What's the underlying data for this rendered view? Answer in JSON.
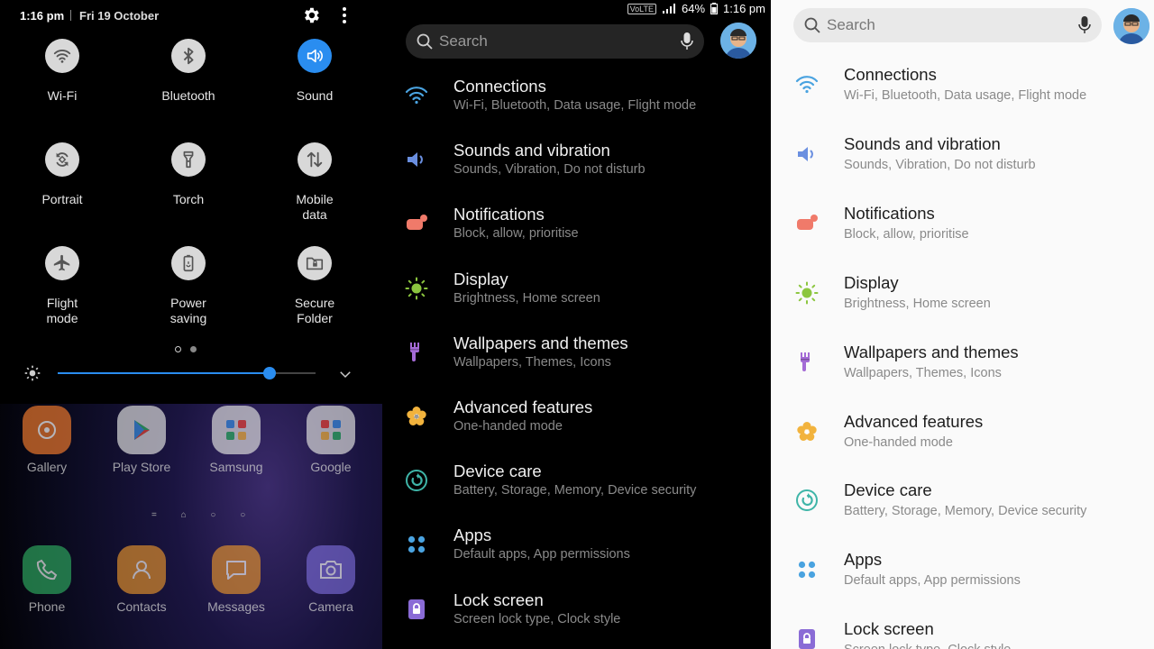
{
  "quick_panel": {
    "time": "1:16 pm",
    "date": "Fri 19 October",
    "tiles": [
      {
        "label": "Wi-Fi",
        "icon": "wifi-icon",
        "active": false
      },
      {
        "label": "Bluetooth",
        "icon": "bluetooth-icon",
        "active": false
      },
      {
        "label": "Sound",
        "icon": "sound-icon",
        "active": true
      },
      {
        "label": "Portrait",
        "icon": "rotate-icon",
        "active": false
      },
      {
        "label": "Torch",
        "icon": "torch-icon",
        "active": false
      },
      {
        "label": "Mobile\ndata",
        "icon": "mobile-data-icon",
        "active": false
      },
      {
        "label": "Flight\nmode",
        "icon": "airplane-icon",
        "active": false
      },
      {
        "label": "Power\nsaving",
        "icon": "battery-icon",
        "active": false
      },
      {
        "label": "Secure\nFolder",
        "icon": "secure-folder-icon",
        "active": false
      }
    ],
    "brightness": 0.82,
    "apps_row1": [
      "Gallery",
      "Play Store",
      "Samsung",
      "Google"
    ],
    "apps_row2": [
      "Phone",
      "Contacts",
      "Messages",
      "Camera"
    ]
  },
  "status_bar": {
    "battery": "64%",
    "time": "1:16 pm",
    "volte": "VoLTE"
  },
  "settings": {
    "search_placeholder": "Search",
    "items": [
      {
        "title": "Connections",
        "subtitle": "Wi-Fi, Bluetooth, Data usage, Flight mode",
        "icon": "wifi-icon",
        "color": "#4aa3e0"
      },
      {
        "title": "Sounds and vibration",
        "subtitle": "Sounds, Vibration, Do not disturb",
        "icon": "volume-icon",
        "color": "#6a8fe0"
      },
      {
        "title": "Notifications",
        "subtitle": "Block, allow, prioritise",
        "icon": "notification-icon",
        "color": "#f07a6a"
      },
      {
        "title": "Display",
        "subtitle": "Brightness, Home screen",
        "icon": "sun-icon",
        "color": "#8cc63f"
      },
      {
        "title": "Wallpapers and themes",
        "subtitle": "Wallpapers, Themes, Icons",
        "icon": "brush-icon",
        "color": "#a46bd6"
      },
      {
        "title": "Advanced features",
        "subtitle": "One-handed mode",
        "icon": "gear-flower-icon",
        "color": "#f2b33d"
      },
      {
        "title": "Device care",
        "subtitle": "Battery, Storage, Memory, Device security",
        "icon": "device-care-icon",
        "color": "#3fb5a8"
      },
      {
        "title": "Apps",
        "subtitle": "Default apps, App permissions",
        "icon": "apps-icon",
        "color": "#4aa3e0"
      },
      {
        "title": "Lock screen",
        "subtitle": "Screen lock type, Clock style",
        "icon": "lock-icon",
        "color": "#8a6bd6"
      }
    ]
  }
}
